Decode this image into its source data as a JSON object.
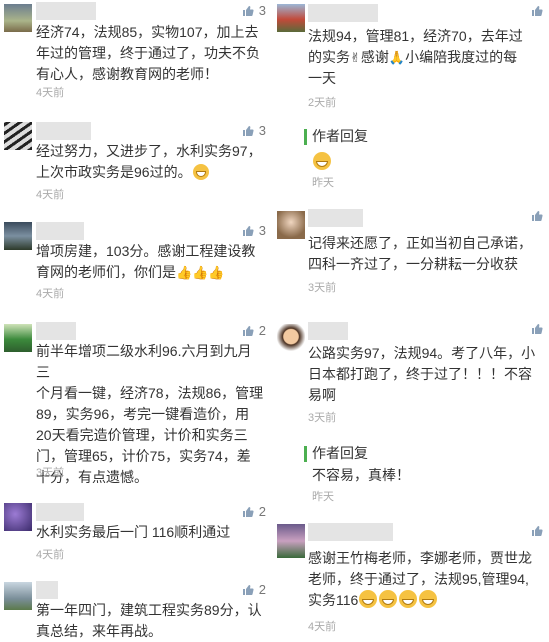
{
  "left": [
    {
      "likes": "3",
      "lines": [
        "经济74，法规85，实物107，加上去",
        "年过的管理，终于通过了，功夫不负",
        "有心人，感谢教育网的老师！"
      ],
      "time": "4天前"
    },
    {
      "likes": "3",
      "lines": [
        "经过努力，又进步了，水利实务97，",
        "上次市政实务是96过的。"
      ],
      "time": "4天前"
    },
    {
      "likes": "3",
      "lines": [
        "增项房建，103分。感谢工程建设教",
        "育网的老师们，你们是"
      ],
      "time": "4天前"
    },
    {
      "likes": "2",
      "lines": [
        "前半年增项二级水利96.六月到九月三",
        "个月看一键，经济78，法规86，管理",
        "89，实务96，考完一键看造价，用",
        "20天看完造价管理，计价和实务三",
        "门，管理65，计价75，实务74，差",
        "十分，有点遗憾。"
      ],
      "time": "3天前"
    },
    {
      "likes": "2",
      "lines": [
        "水利实务最后一门 116顺利通过"
      ],
      "time": "4天前"
    },
    {
      "likes": "2",
      "lines": [
        "第一年四门，建筑工程实务89分，认",
        "真总结，来年再战。"
      ],
      "time": ""
    }
  ],
  "right": [
    {
      "likes": "",
      "lines": [
        "法规94，管理81，经济70，去年过",
        "的实务",
        "感谢",
        "小编陪我度过的每",
        "一天"
      ],
      "time": "2天前"
    },
    {
      "reply_label": "作者回复",
      "time": "昨天"
    },
    {
      "likes": "",
      "lines": [
        "记得来还愿了，正如当初自己承诺，",
        "四科一齐过了，一分耕耘一分收获"
      ],
      "time": "3天前"
    },
    {
      "likes": "",
      "lines": [
        "公路实务97，法规94。考了八年，小",
        "日本都打跑了，终于过了！！！不容",
        "易啊"
      ],
      "time": "3天前"
    },
    {
      "reply_label": "作者回复",
      "text": "不容易，真棒！",
      "time": "昨天"
    },
    {
      "likes": "",
      "lines": [
        "感谢王竹梅老师，李娜老师，贾世龙",
        "老师，终于通过了，法规95,管理94,",
        "实务116"
      ],
      "time": "4天前"
    }
  ],
  "colors": {
    "reply_bar": "#4caf50",
    "like": "#777777",
    "time": "#aaaaaa"
  }
}
